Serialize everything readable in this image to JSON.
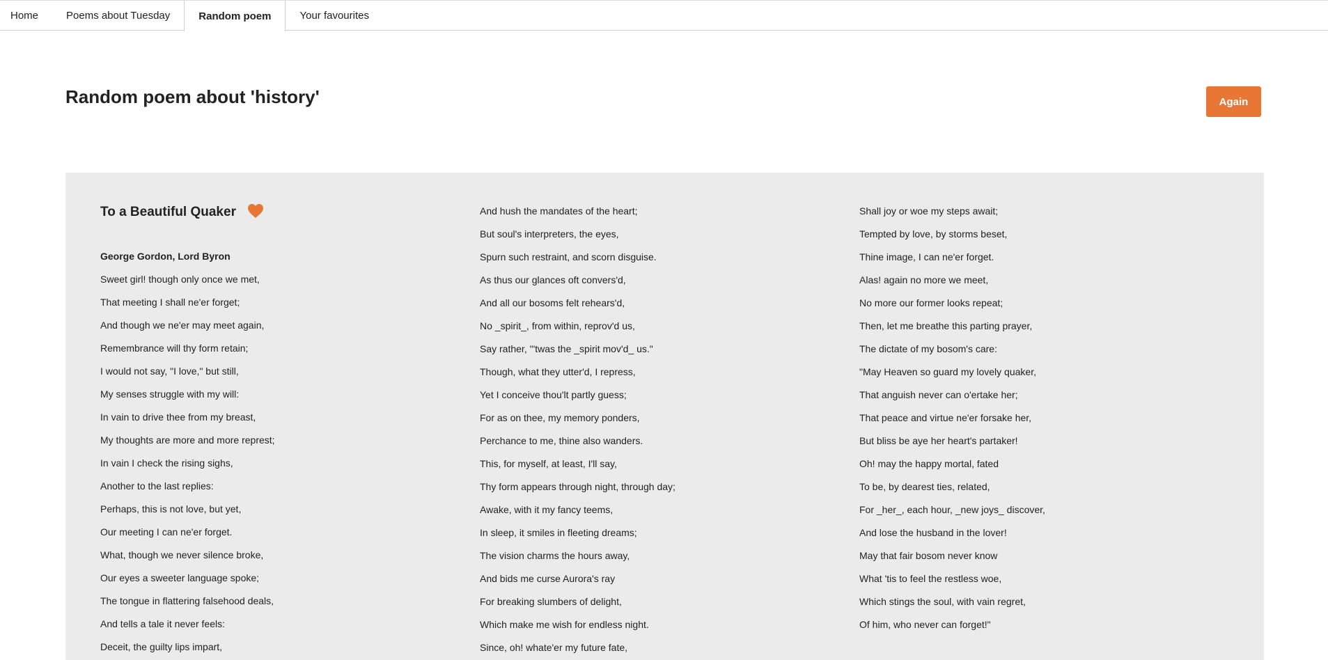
{
  "tabs": [
    {
      "label": "Home"
    },
    {
      "label": "Poems about Tuesday"
    },
    {
      "label": "Random poem"
    },
    {
      "label": "Your favourites"
    }
  ],
  "page": {
    "title": "Random poem about 'history'",
    "again_label": "Again"
  },
  "colors": {
    "accent": "#e87634",
    "panel_bg": "#ebebeb"
  },
  "poem": {
    "title": "To a Beautiful Quaker",
    "favourite_icon": "heart-icon",
    "author": "George Gordon, Lord Byron",
    "column1": [
      "Sweet girl! though only once we met,",
      "That meeting I shall ne'er forget;",
      "And though we ne'er may meet again,",
      "Remembrance will thy form retain;",
      "I would not say, \"I love,\" but still,",
      "My senses struggle with my will:",
      "In vain to drive thee from my breast,",
      "My thoughts are more and more represt;",
      "In vain I check the rising sighs,",
      "Another to the last replies:",
      "Perhaps, this is not love, but yet,",
      "Our meeting I can ne'er forget.",
      "What, though we never silence broke,",
      "Our eyes a sweeter language spoke;",
      "The tongue in flattering falsehood deals,",
      "And tells a tale it never feels:",
      "Deceit, the guilty lips impart,"
    ],
    "column2": [
      "And hush the mandates of the heart;",
      "But soul's interpreters, the eyes,",
      "Spurn such restraint, and scorn disguise.",
      "As thus our glances oft convers'd,",
      "And all our bosoms felt rehears'd,",
      "No _spirit_, from within, reprov'd us,",
      "Say rather, \"'twas the _spirit mov'd_ us.\"",
      "Though, what they utter'd, I repress,",
      "Yet I conceive thou'lt partly guess;",
      "For as on thee, my memory ponders,",
      "Perchance to me, thine also wanders.",
      "This, for myself, at least, I'll say,",
      "Thy form appears through night, through day;",
      "Awake, with it my fancy teems,",
      "In sleep, it smiles in fleeting dreams;",
      "The vision charms the hours away,",
      "And bids me curse Aurora's ray",
      "For breaking slumbers of delight,",
      "Which make me wish for endless night.",
      "Since, oh! whate'er my future fate,"
    ],
    "column3": [
      "Shall joy or woe my steps await;",
      "Tempted by love, by storms beset,",
      "Thine image, I can ne'er forget.",
      "Alas! again no more we meet,",
      "No more our former looks repeat;",
      "Then, let me breathe this parting prayer,",
      "The dictate of my bosom's care:",
      "\"May Heaven so guard my lovely quaker,",
      "That anguish never can o'ertake her;",
      "That peace and virtue ne'er forsake her,",
      "But bliss be aye her heart's partaker!",
      "Oh! may the happy mortal, fated",
      "To be, by dearest ties, related,",
      "For _her_, each hour, _new joys_ discover,",
      "And lose the husband in the lover!",
      "May that fair bosom never know",
      "What 'tis to feel the restless woe,",
      "Which stings the soul, with vain regret,",
      "Of him, who never can forget!\""
    ]
  }
}
